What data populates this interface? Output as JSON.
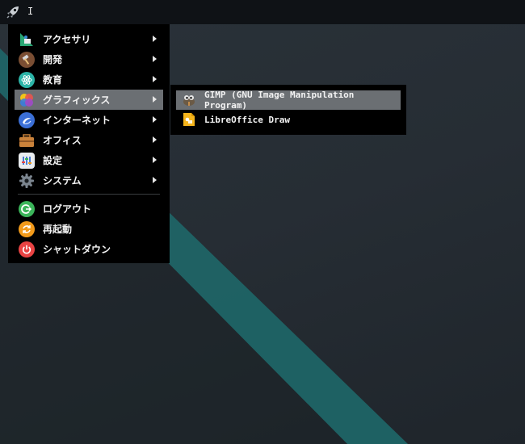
{
  "panel": {
    "launcher_icon": "rocket-icon",
    "text": "I"
  },
  "main_menu": {
    "items": [
      {
        "label": "アクセサリ",
        "icon": "accessories-icon",
        "color": "#2aa876"
      },
      {
        "label": "開発",
        "icon": "development-hammer-icon",
        "color": "#8a5a3c"
      },
      {
        "label": "教育",
        "icon": "education-atom-icon",
        "color": "#2cb5a8"
      },
      {
        "label": "グラフィックス",
        "icon": "graphics-icon",
        "color": "#e8554e"
      },
      {
        "label": "インターネット",
        "icon": "internet-icon",
        "color": "#3b6fd6"
      },
      {
        "label": "オフィス",
        "icon": "office-briefcase-icon",
        "color": "#c9823b"
      },
      {
        "label": "設定",
        "icon": "settings-icon",
        "color": "#4a7bd0"
      },
      {
        "label": "システム",
        "icon": "system-gear-icon",
        "color": "#5d6670"
      }
    ],
    "session_items": [
      {
        "label": "ログアウト",
        "icon": "logout-icon",
        "color": "#3bb55a"
      },
      {
        "label": "再起動",
        "icon": "restart-icon",
        "color": "#f29a1a"
      },
      {
        "label": "シャットダウン",
        "icon": "shutdown-icon",
        "color": "#e94343"
      }
    ]
  },
  "submenu": {
    "items": [
      {
        "label": "GIMP (GNU Image Manipulation Program)",
        "icon": "gimp-icon"
      },
      {
        "label": "LibreOffice Draw",
        "icon": "libreoffice-draw-icon",
        "color": "#f5b51c"
      }
    ]
  }
}
